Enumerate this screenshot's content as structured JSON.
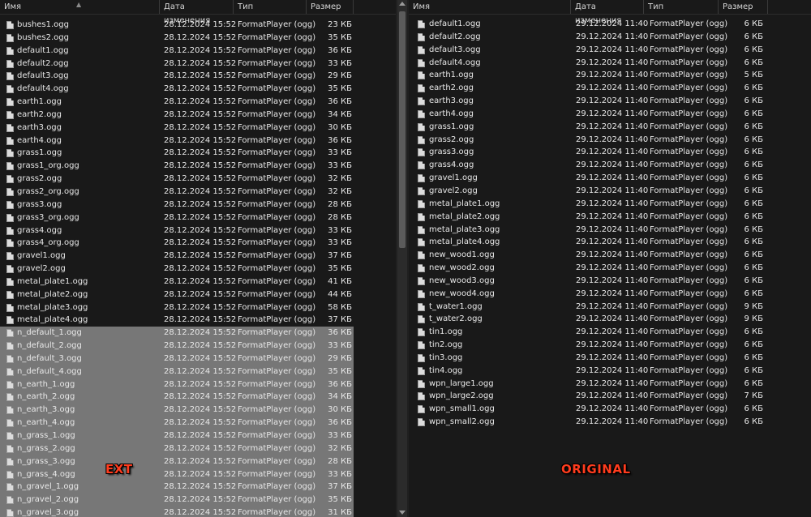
{
  "left": {
    "columns": {
      "name": "Имя",
      "date": "Дата изменения",
      "type": "Тип",
      "size": "Размер"
    },
    "rows": [
      {
        "name": "bushes1.ogg",
        "date": "28.12.2024 15:52",
        "type": "FormatPlayer (ogg)",
        "size": "23 КБ",
        "selected": false
      },
      {
        "name": "bushes2.ogg",
        "date": "28.12.2024 15:52",
        "type": "FormatPlayer (ogg)",
        "size": "35 КБ",
        "selected": false
      },
      {
        "name": "default1.ogg",
        "date": "28.12.2024 15:52",
        "type": "FormatPlayer (ogg)",
        "size": "36 КБ",
        "selected": false
      },
      {
        "name": "default2.ogg",
        "date": "28.12.2024 15:52",
        "type": "FormatPlayer (ogg)",
        "size": "33 КБ",
        "selected": false
      },
      {
        "name": "default3.ogg",
        "date": "28.12.2024 15:52",
        "type": "FormatPlayer (ogg)",
        "size": "29 КБ",
        "selected": false
      },
      {
        "name": "default4.ogg",
        "date": "28.12.2024 15:52",
        "type": "FormatPlayer (ogg)",
        "size": "35 КБ",
        "selected": false
      },
      {
        "name": "earth1.ogg",
        "date": "28.12.2024 15:52",
        "type": "FormatPlayer (ogg)",
        "size": "36 КБ",
        "selected": false
      },
      {
        "name": "earth2.ogg",
        "date": "28.12.2024 15:52",
        "type": "FormatPlayer (ogg)",
        "size": "34 КБ",
        "selected": false
      },
      {
        "name": "earth3.ogg",
        "date": "28.12.2024 15:52",
        "type": "FormatPlayer (ogg)",
        "size": "30 КБ",
        "selected": false
      },
      {
        "name": "earth4.ogg",
        "date": "28.12.2024 15:52",
        "type": "FormatPlayer (ogg)",
        "size": "36 КБ",
        "selected": false
      },
      {
        "name": "grass1.ogg",
        "date": "28.12.2024 15:52",
        "type": "FormatPlayer (ogg)",
        "size": "33 КБ",
        "selected": false
      },
      {
        "name": "grass1_org.ogg",
        "date": "28.12.2024 15:52",
        "type": "FormatPlayer (ogg)",
        "size": "33 КБ",
        "selected": false
      },
      {
        "name": "grass2.ogg",
        "date": "28.12.2024 15:52",
        "type": "FormatPlayer (ogg)",
        "size": "32 КБ",
        "selected": false
      },
      {
        "name": "grass2_org.ogg",
        "date": "28.12.2024 15:52",
        "type": "FormatPlayer (ogg)",
        "size": "32 КБ",
        "selected": false
      },
      {
        "name": "grass3.ogg",
        "date": "28.12.2024 15:52",
        "type": "FormatPlayer (ogg)",
        "size": "28 КБ",
        "selected": false
      },
      {
        "name": "grass3_org.ogg",
        "date": "28.12.2024 15:52",
        "type": "FormatPlayer (ogg)",
        "size": "28 КБ",
        "selected": false
      },
      {
        "name": "grass4.ogg",
        "date": "28.12.2024 15:52",
        "type": "FormatPlayer (ogg)",
        "size": "33 КБ",
        "selected": false
      },
      {
        "name": "grass4_org.ogg",
        "date": "28.12.2024 15:52",
        "type": "FormatPlayer (ogg)",
        "size": "33 КБ",
        "selected": false
      },
      {
        "name": "gravel1.ogg",
        "date": "28.12.2024 15:52",
        "type": "FormatPlayer (ogg)",
        "size": "37 КБ",
        "selected": false
      },
      {
        "name": "gravel2.ogg",
        "date": "28.12.2024 15:52",
        "type": "FormatPlayer (ogg)",
        "size": "35 КБ",
        "selected": false
      },
      {
        "name": "metal_plate1.ogg",
        "date": "28.12.2024 15:52",
        "type": "FormatPlayer (ogg)",
        "size": "41 КБ",
        "selected": false
      },
      {
        "name": "metal_plate2.ogg",
        "date": "28.12.2024 15:52",
        "type": "FormatPlayer (ogg)",
        "size": "44 КБ",
        "selected": false
      },
      {
        "name": "metal_plate3.ogg",
        "date": "28.12.2024 15:52",
        "type": "FormatPlayer (ogg)",
        "size": "58 КБ",
        "selected": false
      },
      {
        "name": "metal_plate4.ogg",
        "date": "28.12.2024 15:52",
        "type": "FormatPlayer (ogg)",
        "size": "37 КБ",
        "selected": false
      },
      {
        "name": "n_default_1.ogg",
        "date": "28.12.2024 15:52",
        "type": "FormatPlayer (ogg)",
        "size": "36 КБ",
        "selected": true
      },
      {
        "name": "n_default_2.ogg",
        "date": "28.12.2024 15:52",
        "type": "FormatPlayer (ogg)",
        "size": "33 КБ",
        "selected": true
      },
      {
        "name": "n_default_3.ogg",
        "date": "28.12.2024 15:52",
        "type": "FormatPlayer (ogg)",
        "size": "29 КБ",
        "selected": true
      },
      {
        "name": "n_default_4.ogg",
        "date": "28.12.2024 15:52",
        "type": "FormatPlayer (ogg)",
        "size": "35 КБ",
        "selected": true
      },
      {
        "name": "n_earth_1.ogg",
        "date": "28.12.2024 15:52",
        "type": "FormatPlayer (ogg)",
        "size": "36 КБ",
        "selected": true
      },
      {
        "name": "n_earth_2.ogg",
        "date": "28.12.2024 15:52",
        "type": "FormatPlayer (ogg)",
        "size": "34 КБ",
        "selected": true
      },
      {
        "name": "n_earth_3.ogg",
        "date": "28.12.2024 15:52",
        "type": "FormatPlayer (ogg)",
        "size": "30 КБ",
        "selected": true
      },
      {
        "name": "n_earth_4.ogg",
        "date": "28.12.2024 15:52",
        "type": "FormatPlayer (ogg)",
        "size": "36 КБ",
        "selected": true
      },
      {
        "name": "n_grass_1.ogg",
        "date": "28.12.2024 15:52",
        "type": "FormatPlayer (ogg)",
        "size": "33 КБ",
        "selected": true
      },
      {
        "name": "n_grass_2.ogg",
        "date": "28.12.2024 15:52",
        "type": "FormatPlayer (ogg)",
        "size": "32 КБ",
        "selected": true
      },
      {
        "name": "n_grass_3.ogg",
        "date": "28.12.2024 15:52",
        "type": "FormatPlayer (ogg)",
        "size": "28 КБ",
        "selected": true
      },
      {
        "name": "n_grass_4.ogg",
        "date": "28.12.2024 15:52",
        "type": "FormatPlayer (ogg)",
        "size": "33 КБ",
        "selected": true
      },
      {
        "name": "n_gravel_1.ogg",
        "date": "28.12.2024 15:52",
        "type": "FormatPlayer (ogg)",
        "size": "37 КБ",
        "selected": true
      },
      {
        "name": "n_gravel_2.ogg",
        "date": "28.12.2024 15:52",
        "type": "FormatPlayer (ogg)",
        "size": "35 КБ",
        "selected": true
      },
      {
        "name": "n_gravel_3.ogg",
        "date": "28.12.2024 15:52",
        "type": "FormatPlayer (ogg)",
        "size": "31 КБ",
        "selected": true
      }
    ],
    "overlay_label": "EXT"
  },
  "right": {
    "columns": {
      "name": "Имя",
      "date": "Дата изменения",
      "type": "Тип",
      "size": "Размер"
    },
    "rows": [
      {
        "name": "default1.ogg",
        "date": "29.12.2024 11:40",
        "type": "FormatPlayer (ogg)",
        "size": "6 КБ"
      },
      {
        "name": "default2.ogg",
        "date": "29.12.2024 11:40",
        "type": "FormatPlayer (ogg)",
        "size": "6 КБ"
      },
      {
        "name": "default3.ogg",
        "date": "29.12.2024 11:40",
        "type": "FormatPlayer (ogg)",
        "size": "6 КБ"
      },
      {
        "name": "default4.ogg",
        "date": "29.12.2024 11:40",
        "type": "FormatPlayer (ogg)",
        "size": "6 КБ"
      },
      {
        "name": "earth1.ogg",
        "date": "29.12.2024 11:40",
        "type": "FormatPlayer (ogg)",
        "size": "5 КБ"
      },
      {
        "name": "earth2.ogg",
        "date": "29.12.2024 11:40",
        "type": "FormatPlayer (ogg)",
        "size": "6 КБ"
      },
      {
        "name": "earth3.ogg",
        "date": "29.12.2024 11:40",
        "type": "FormatPlayer (ogg)",
        "size": "6 КБ"
      },
      {
        "name": "earth4.ogg",
        "date": "29.12.2024 11:40",
        "type": "FormatPlayer (ogg)",
        "size": "6 КБ"
      },
      {
        "name": "grass1.ogg",
        "date": "29.12.2024 11:40",
        "type": "FormatPlayer (ogg)",
        "size": "6 КБ"
      },
      {
        "name": "grass2.ogg",
        "date": "29.12.2024 11:40",
        "type": "FormatPlayer (ogg)",
        "size": "6 КБ"
      },
      {
        "name": "grass3.ogg",
        "date": "29.12.2024 11:40",
        "type": "FormatPlayer (ogg)",
        "size": "6 КБ"
      },
      {
        "name": "grass4.ogg",
        "date": "29.12.2024 11:40",
        "type": "FormatPlayer (ogg)",
        "size": "6 КБ"
      },
      {
        "name": "gravel1.ogg",
        "date": "29.12.2024 11:40",
        "type": "FormatPlayer (ogg)",
        "size": "6 КБ"
      },
      {
        "name": "gravel2.ogg",
        "date": "29.12.2024 11:40",
        "type": "FormatPlayer (ogg)",
        "size": "6 КБ"
      },
      {
        "name": "metal_plate1.ogg",
        "date": "29.12.2024 11:40",
        "type": "FormatPlayer (ogg)",
        "size": "6 КБ"
      },
      {
        "name": "metal_plate2.ogg",
        "date": "29.12.2024 11:40",
        "type": "FormatPlayer (ogg)",
        "size": "6 КБ"
      },
      {
        "name": "metal_plate3.ogg",
        "date": "29.12.2024 11:40",
        "type": "FormatPlayer (ogg)",
        "size": "6 КБ"
      },
      {
        "name": "metal_plate4.ogg",
        "date": "29.12.2024 11:40",
        "type": "FormatPlayer (ogg)",
        "size": "6 КБ"
      },
      {
        "name": "new_wood1.ogg",
        "date": "29.12.2024 11:40",
        "type": "FormatPlayer (ogg)",
        "size": "6 КБ"
      },
      {
        "name": "new_wood2.ogg",
        "date": "29.12.2024 11:40",
        "type": "FormatPlayer (ogg)",
        "size": "6 КБ"
      },
      {
        "name": "new_wood3.ogg",
        "date": "29.12.2024 11:40",
        "type": "FormatPlayer (ogg)",
        "size": "6 КБ"
      },
      {
        "name": "new_wood4.ogg",
        "date": "29.12.2024 11:40",
        "type": "FormatPlayer (ogg)",
        "size": "6 КБ"
      },
      {
        "name": "t_water1.ogg",
        "date": "29.12.2024 11:40",
        "type": "FormatPlayer (ogg)",
        "size": "9 КБ"
      },
      {
        "name": "t_water2.ogg",
        "date": "29.12.2024 11:40",
        "type": "FormatPlayer (ogg)",
        "size": "9 КБ"
      },
      {
        "name": "tin1.ogg",
        "date": "29.12.2024 11:40",
        "type": "FormatPlayer (ogg)",
        "size": "6 КБ"
      },
      {
        "name": "tin2.ogg",
        "date": "29.12.2024 11:40",
        "type": "FormatPlayer (ogg)",
        "size": "6 КБ"
      },
      {
        "name": "tin3.ogg",
        "date": "29.12.2024 11:40",
        "type": "FormatPlayer (ogg)",
        "size": "6 КБ"
      },
      {
        "name": "tin4.ogg",
        "date": "29.12.2024 11:40",
        "type": "FormatPlayer (ogg)",
        "size": "6 КБ"
      },
      {
        "name": "wpn_large1.ogg",
        "date": "29.12.2024 11:40",
        "type": "FormatPlayer (ogg)",
        "size": "6 КБ"
      },
      {
        "name": "wpn_large2.ogg",
        "date": "29.12.2024 11:40",
        "type": "FormatPlayer (ogg)",
        "size": "7 КБ"
      },
      {
        "name": "wpn_small1.ogg",
        "date": "29.12.2024 11:40",
        "type": "FormatPlayer (ogg)",
        "size": "6 КБ"
      },
      {
        "name": "wpn_small2.ogg",
        "date": "29.12.2024 11:40",
        "type": "FormatPlayer (ogg)",
        "size": "6 КБ"
      }
    ],
    "overlay_label": "ORIGINAL"
  },
  "icons": {
    "file": "audio-file-icon",
    "sort": "sort-caret-icon"
  },
  "colors": {
    "background": "#191919",
    "selection": "#777777",
    "label_red": "#ff3c1e"
  }
}
